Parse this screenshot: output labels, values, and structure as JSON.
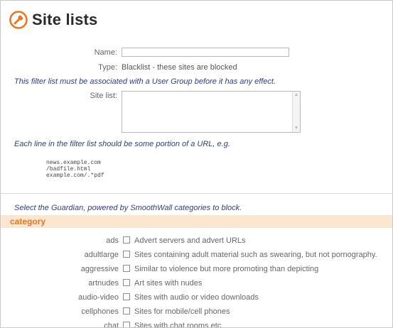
{
  "page": {
    "title": "Site lists"
  },
  "form": {
    "name_label": "Name:",
    "name_value": "",
    "type_label": "Type:",
    "type_value": "Blacklist - these sites are blocked",
    "assoc_note": "This filter list must be associated with a User Group before it has any effect.",
    "site_list_label": "Site list:",
    "site_list_value": "",
    "line_note": "Each line in the filter list should be some portion of a URL, e.g.",
    "examples": [
      "news.example.com",
      "/badfile.html",
      "example.com/.*pdf"
    ]
  },
  "categories": {
    "intro": "Select the Guardian, powered by SmoothWall categories to block.",
    "header": "category",
    "items": [
      {
        "name": "ads",
        "desc": "Advert servers and advert URLs",
        "checked": false
      },
      {
        "name": "adultlarge",
        "desc": "Sites containing adult material such as swearing, but not pornography.",
        "checked": false
      },
      {
        "name": "aggressive",
        "desc": "Similar to violence but more promoting than depicting",
        "checked": false
      },
      {
        "name": "artnudes",
        "desc": "Art sites with nudes",
        "checked": false
      },
      {
        "name": "audio-video",
        "desc": "Sites with audio or video downloads",
        "checked": false
      },
      {
        "name": "cellphones",
        "desc": "Sites for mobile/cell phones",
        "checked": false
      },
      {
        "name": "chat",
        "desc": "Sites with chat rooms etc",
        "checked": false
      }
    ]
  },
  "colors": {
    "accent": "#e87722",
    "note": "#2b3f8c",
    "header_bg": "#fbe6d0"
  }
}
